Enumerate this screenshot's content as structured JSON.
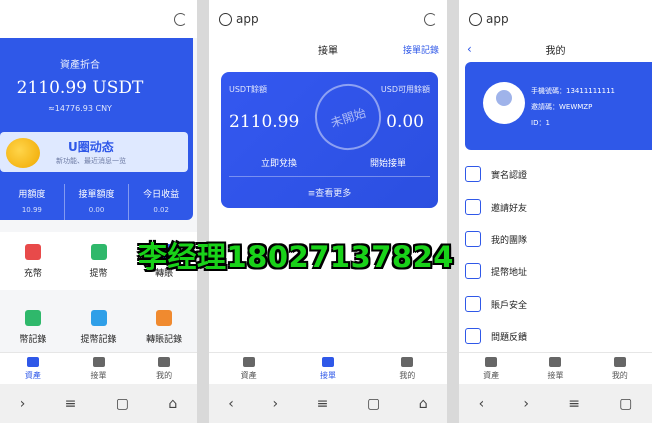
{
  "app_label": "app",
  "overlay_text": "李经理18027137824",
  "panel1": {
    "assets_title": "資產折合",
    "assets_value": "2110.99 USDT",
    "assets_cny": "≈14776.93 CNY",
    "banner_title": "U圈动态",
    "banner_sub": "新功能、最近消息一览",
    "stats": [
      {
        "label": "用額度",
        "value": "10.99"
      },
      {
        "label": "接單額度",
        "value": "0.00"
      },
      {
        "label": "今日收益",
        "value": "0.02"
      }
    ],
    "grid_row1": [
      {
        "label": "充幣",
        "color": "#e84a4a"
      },
      {
        "label": "提幣",
        "color": "#2fb86b"
      },
      {
        "label": "轉賬",
        "color": "#2f58e8"
      }
    ],
    "grid_row2": [
      {
        "label": "幣記錄",
        "color": "#2fb86b"
      },
      {
        "label": "提幣記錄",
        "color": "#2f9fe8"
      },
      {
        "label": "轉賬記錄",
        "color": "#f08a2f"
      }
    ]
  },
  "panel2": {
    "header_title": "接單",
    "header_right": "接單記錄",
    "usdt_balance_label": "USDT餘額",
    "usd_available_label": "USD可用餘額",
    "usdt_balance_value": "2110.99",
    "usd_available_value": "0.00",
    "stamp_text": "未開始",
    "exchange_button": "立即兌換",
    "start_button": "開始接單",
    "view_more": "≡查看更多"
  },
  "panel3": {
    "header_title": "我的",
    "phone": "手機號碼：13411111111",
    "invite": "邀請碼：WEWMZP",
    "id": "ID：1",
    "menu": [
      {
        "label": "實名認證"
      },
      {
        "label": "邀請好友"
      },
      {
        "label": "我的團隊"
      },
      {
        "label": "提幣地址"
      },
      {
        "label": "賬戶安全"
      },
      {
        "label": "問題反饋"
      }
    ]
  },
  "tabs": [
    "資產",
    "接單",
    "我的"
  ],
  "sysnav": [
    "‹",
    "›",
    "≡",
    "▢",
    "⌂"
  ]
}
